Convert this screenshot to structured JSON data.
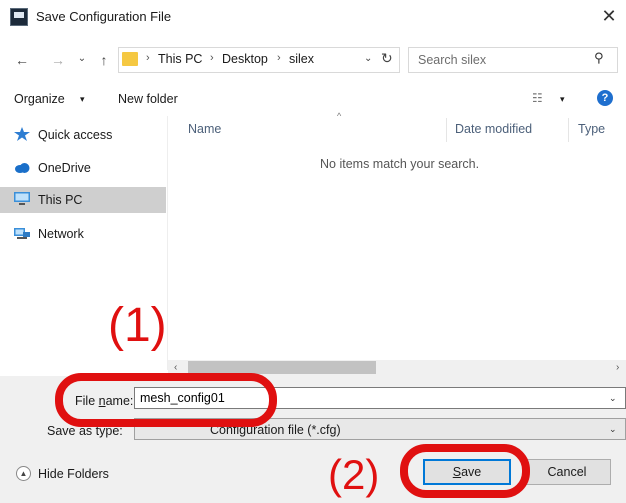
{
  "window": {
    "title": "Save Configuration File",
    "close_glyph": "✕"
  },
  "nav": {
    "back_glyph": "←",
    "forward_glyph": "→",
    "recent_glyph": "⌄",
    "up_glyph": "↑",
    "breadcrumb": [
      "This PC",
      "Desktop",
      "silex"
    ],
    "breadcrumb_sep": "›",
    "dropdown_glyph": "⌄",
    "refresh_glyph": "↻",
    "search_placeholder": "Search silex",
    "search_glyph": "⚲"
  },
  "commandbar": {
    "organize_label": "Organize",
    "caret_glyph": "▾",
    "new_folder_label": "New folder",
    "view_glyph": "☷",
    "help_glyph": "?"
  },
  "sidebar": {
    "items": [
      {
        "label": "Quick access",
        "icon": "star-icon"
      },
      {
        "label": "OneDrive",
        "icon": "cloud-icon"
      },
      {
        "label": "This PC",
        "icon": "monitor-icon",
        "selected": true
      },
      {
        "label": "Network",
        "icon": "network-icon"
      }
    ]
  },
  "filelist": {
    "columns": [
      "Name",
      "Date modified",
      "Type"
    ],
    "sort_glyph": "^",
    "empty_message": "No items match your search."
  },
  "scroll": {
    "left_glyph": "‹",
    "right_glyph": "›"
  },
  "form": {
    "file_name_label_pre": "File ",
    "file_name_label_u": "n",
    "file_name_label_post": "ame:",
    "file_name_value": "mesh_config01",
    "save_type_label": "Save as type:",
    "save_type_value": "Configuration file (*.cfg)",
    "dropdown_glyph": "⌄"
  },
  "footer": {
    "hide_folders_label": "Hide Folders",
    "hide_glyph": "▲",
    "save_label_u": "S",
    "save_label_rest": "ave",
    "cancel_label": "Cancel"
  },
  "annotations": {
    "step1": "(1)",
    "step2": "(2)"
  },
  "colors": {
    "accent": "#0078d7",
    "annotation": "#e01010",
    "selection": "#cfcfcf"
  }
}
